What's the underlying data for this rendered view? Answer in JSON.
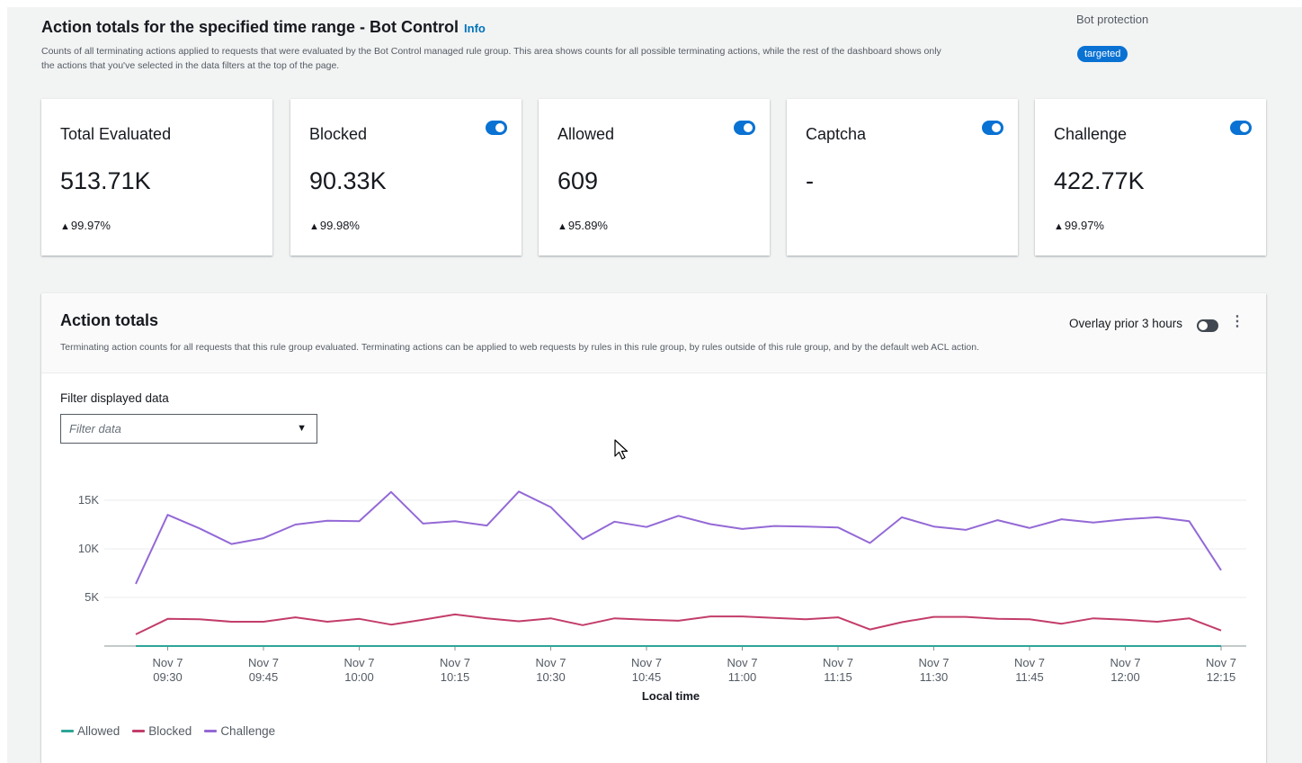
{
  "header": {
    "title": "Action totals for the specified time range - Bot Control",
    "info_link": "Info",
    "description": "Counts of all terminating actions applied to requests that were evaluated by the Bot Control managed rule group. This area shows counts for all possible terminating actions, while the rest of the dashboard shows only the actions that you've selected in the data filters at the top of the page.",
    "bot_protection_label": "Bot protection",
    "bot_protection_badge": "targeted"
  },
  "cards": [
    {
      "title": "Total Evaluated",
      "value": "513.71K",
      "change": "99.97%",
      "toggle": false
    },
    {
      "title": "Blocked",
      "value": "90.33K",
      "change": "99.98%",
      "toggle": true,
      "toggle_on": true
    },
    {
      "title": "Allowed",
      "value": "609",
      "change": "95.89%",
      "toggle": true,
      "toggle_on": true
    },
    {
      "title": "Captcha",
      "value": "-",
      "change": "",
      "toggle": true,
      "toggle_on": true
    },
    {
      "title": "Challenge",
      "value": "422.77K",
      "change": "99.97%",
      "toggle": true,
      "toggle_on": true
    }
  ],
  "panel": {
    "title": "Action totals",
    "description": "Terminating action counts for all requests that this rule group evaluated. Terminating actions can be applied to web requests by rules in this rule group, by rules outside of this rule group, and by the default web ACL action.",
    "overlay_label": "Overlay prior 3 hours",
    "overlay_on": false,
    "filter_label": "Filter displayed data",
    "filter_placeholder": "Filter data"
  },
  "colors": {
    "allowed": "#2ea597",
    "blocked": "#c33d69",
    "challenge": "#9469d6",
    "toggle_on": "#0972d3",
    "link": "#0073bb"
  },
  "chart_data": {
    "type": "line",
    "xlabel": "Local time",
    "ylabel": "",
    "ylim": [
      0,
      17000
    ],
    "y_ticks": [
      "5K",
      "10K",
      "15K"
    ],
    "x_ticks": [
      [
        "Nov 7",
        "09:30"
      ],
      [
        "Nov 7",
        "09:45"
      ],
      [
        "Nov 7",
        "10:00"
      ],
      [
        "Nov 7",
        "10:15"
      ],
      [
        "Nov 7",
        "10:30"
      ],
      [
        "Nov 7",
        "10:45"
      ],
      [
        "Nov 7",
        "11:00"
      ],
      [
        "Nov 7",
        "11:15"
      ],
      [
        "Nov 7",
        "11:30"
      ],
      [
        "Nov 7",
        "11:45"
      ],
      [
        "Nov 7",
        "12:00"
      ],
      [
        "Nov 7",
        "12:15"
      ]
    ],
    "x": [
      "09:25",
      "09:30",
      "09:35",
      "09:40",
      "09:45",
      "09:50",
      "09:55",
      "10:00",
      "10:05",
      "10:10",
      "10:15",
      "10:20",
      "10:25",
      "10:30",
      "10:35",
      "10:40",
      "10:45",
      "10:50",
      "10:55",
      "11:00",
      "11:05",
      "11:10",
      "11:15",
      "11:20",
      "11:25",
      "11:30",
      "11:35",
      "11:40",
      "11:45",
      "11:50",
      "11:55",
      "12:00",
      "12:05",
      "12:10",
      "12:15"
    ],
    "series": [
      {
        "name": "Allowed",
        "color": "#2ea597",
        "values": [
          0,
          0,
          0,
          0,
          0,
          0,
          0,
          0,
          0,
          0,
          0,
          0,
          0,
          0,
          0,
          0,
          0,
          0,
          0,
          0,
          0,
          0,
          0,
          0,
          0,
          0,
          0,
          0,
          0,
          0,
          0,
          0,
          0,
          0,
          0
        ]
      },
      {
        "name": "Blocked",
        "color": "#c33d69",
        "values": [
          1200,
          2800,
          2750,
          2500,
          2500,
          2950,
          2500,
          2800,
          2200,
          2700,
          3250,
          2850,
          2550,
          2850,
          2150,
          2850,
          2700,
          2600,
          3050,
          3050,
          2900,
          2750,
          2950,
          1700,
          2450,
          3000,
          3000,
          2800,
          2750,
          2300,
          2850,
          2700,
          2500,
          2850,
          1600
        ]
      },
      {
        "name": "Challenge",
        "color": "#9469d6",
        "values": [
          6400,
          13500,
          12100,
          10500,
          11100,
          12500,
          12900,
          12850,
          15850,
          12600,
          12850,
          12400,
          15900,
          14300,
          11000,
          12800,
          12250,
          13400,
          12550,
          12050,
          12350,
          12300,
          12200,
          10600,
          13250,
          12300,
          11950,
          12950,
          12150,
          13050,
          12700,
          13050,
          13250,
          12850,
          7800
        ]
      }
    ]
  }
}
